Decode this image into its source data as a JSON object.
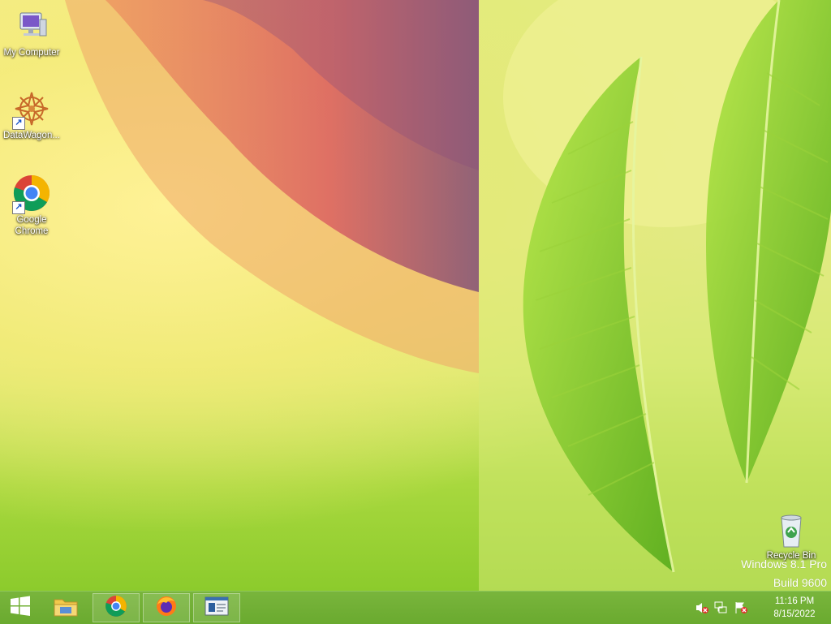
{
  "desktop": {
    "icons": [
      {
        "label": "My Computer",
        "icon": "computer-icon"
      },
      {
        "label": "DataWagon...",
        "icon": "datawagon-icon"
      },
      {
        "label": "Google Chrome",
        "icon": "chrome-icon"
      },
      {
        "label": "Recycle Bin",
        "icon": "recycle-bin-icon"
      }
    ],
    "watermark": {
      "edition": "Windows 8.1 Pro",
      "build": "Build 9600"
    }
  },
  "taskbar": {
    "start": {
      "icon": "windows-logo-icon"
    },
    "pinned": [
      {
        "name": "File Explorer",
        "icon": "folder-icon"
      },
      {
        "name": "Google Chrome",
        "icon": "chrome-icon"
      },
      {
        "name": "Firefox",
        "icon": "firefox-icon"
      },
      {
        "name": "Application window",
        "icon": "window-app-icon"
      }
    ],
    "tray": {
      "icons": [
        "speaker-muted-icon",
        "network-icon",
        "action-center-flag-icon"
      ],
      "time": "11:16 PM",
      "date": "8/15/2022"
    }
  },
  "colors": {
    "taskbar": "#6aaa2f",
    "chrome_red": "#db4437",
    "chrome_yellow": "#f4b400",
    "chrome_green": "#0f9d58",
    "chrome_blue": "#4285f4"
  }
}
